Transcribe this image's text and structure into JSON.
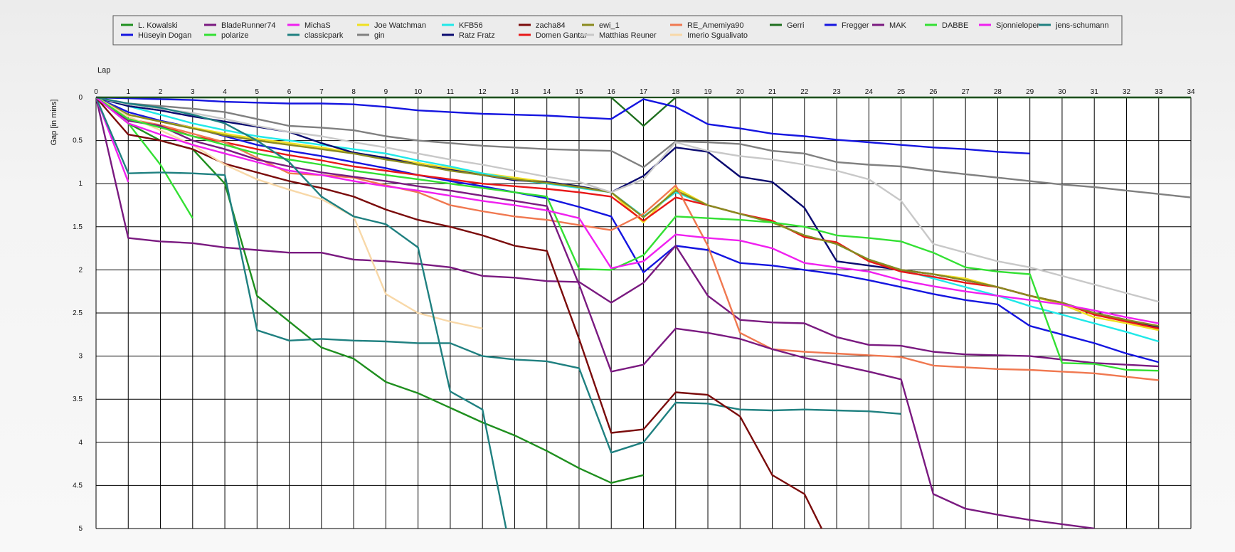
{
  "chart_data": {
    "type": "line",
    "xlabel": "Lap",
    "ylabel": "Gap [in mins]",
    "xlim": [
      0,
      34
    ],
    "ylim": [
      0,
      5
    ],
    "y_inverted": true,
    "x_ticks": [
      0,
      1,
      2,
      3,
      4,
      5,
      6,
      7,
      8,
      9,
      10,
      11,
      12,
      13,
      14,
      15,
      16,
      17,
      18,
      19,
      20,
      21,
      22,
      23,
      24,
      25,
      26,
      27,
      28,
      29,
      30,
      31,
      32,
      33,
      34
    ],
    "y_ticks": [
      0,
      0.5,
      1,
      1.5,
      2,
      2.5,
      3,
      3.5,
      4,
      4.5,
      5
    ],
    "y_tick_labels": [
      "0",
      "0.5",
      "1",
      "1.5",
      "2",
      "2.5",
      "3",
      "3.5",
      "4",
      "4.5",
      "5"
    ],
    "grid": true,
    "legend_position": "top",
    "series": [
      {
        "name": "L. Kowalski",
        "color": "#1f8f1f",
        "values": [
          0,
          0.3,
          0.5,
          0.6,
          1.0,
          2.3,
          2.6,
          2.9,
          3.03,
          3.3,
          3.43,
          3.6,
          3.77,
          3.92,
          4.1,
          4.3,
          4.47,
          4.38
        ]
      },
      {
        "name": "Hüseyin  Dogan",
        "color": "#1515e0",
        "values": [
          0,
          0.17,
          0.27,
          0.35,
          0.45,
          0.55,
          0.62,
          0.68,
          0.75,
          0.82,
          0.9,
          0.97,
          1.03,
          1.1,
          1.17,
          1.27,
          1.38,
          2.03,
          1.72,
          1.77,
          1.92,
          1.95,
          2.0,
          2.05,
          2.12,
          2.2,
          2.28,
          2.35,
          2.4,
          2.65,
          2.75,
          2.85,
          2.97,
          3.07
        ]
      },
      {
        "name": "BladeRunner74",
        "color": "#7a1a80",
        "values": [
          0,
          1.63,
          1.67,
          1.69,
          1.74,
          1.77,
          1.8,
          1.8,
          1.88,
          1.9,
          1.93,
          1.97,
          2.07,
          2.09,
          2.13,
          2.14,
          2.38,
          2.15,
          1.72,
          2.3,
          2.58,
          2.61,
          2.62,
          2.78,
          2.87,
          2.88,
          2.95,
          2.98,
          2.99,
          3.0,
          3.04,
          3.08,
          3.1,
          3.12
        ]
      },
      {
        "name": "polarize",
        "color": "#33e033",
        "values": [
          0,
          0.3,
          0.78,
          1.4
        ]
      },
      {
        "name": "MichaS",
        "color": "#f020f0",
        "values": [
          0,
          0.98
        ]
      },
      {
        "name": "classicpark",
        "color": "#1f8080",
        "values": [
          0,
          0.88,
          0.87,
          0.88,
          0.9,
          2.7,
          2.82,
          2.8,
          2.82,
          2.83,
          2.85,
          2.85,
          3.0,
          3.04,
          3.06,
          3.14,
          4.12,
          4.0,
          3.54,
          3.55,
          3.62,
          3.63,
          3.62,
          3.63,
          3.64,
          3.67
        ]
      },
      {
        "name": "Joe Watchman",
        "color": "#f0e020",
        "values": [
          0,
          0.2,
          0.28,
          0.35,
          0.42,
          0.48,
          0.53,
          0.58,
          0.64,
          0.7,
          0.76,
          0.82,
          0.88,
          0.93,
          0.98,
          1.03,
          1.1,
          1.45,
          1.05,
          1.25,
          1.35,
          1.45,
          1.6,
          1.7,
          1.88,
          2.0,
          2.05,
          2.1,
          2.2,
          2.3,
          2.4,
          2.55,
          2.62,
          2.7
        ]
      },
      {
        "name": "gin",
        "color": "#808080",
        "values": [
          0,
          0.07,
          0.1,
          0.13,
          0.17,
          0.25,
          0.33,
          0.35,
          0.38,
          0.45,
          0.5,
          0.53,
          0.56,
          0.58,
          0.6,
          0.61,
          0.62,
          0.81,
          0.51,
          0.52,
          0.54,
          0.62,
          0.65,
          0.75,
          0.78,
          0.8,
          0.85,
          0.89,
          0.93,
          0.97,
          1.01,
          1.04,
          1.08,
          1.12,
          1.16
        ]
      },
      {
        "name": "KFB56",
        "color": "#20e8e8",
        "values": [
          0,
          0.1,
          0.2,
          0.3,
          0.38,
          0.45,
          0.5,
          0.55,
          0.6,
          0.65,
          0.73,
          0.8,
          0.88,
          0.95,
          1.0,
          1.05,
          1.1,
          1.38,
          1.1,
          1.25,
          1.35,
          1.45,
          1.6,
          1.7,
          1.88,
          2.0,
          2.1,
          2.2,
          2.3,
          2.42,
          2.52,
          2.62,
          2.72,
          2.83
        ]
      },
      {
        "name": "Ratz Fratz",
        "color": "#0a0a70",
        "values": [
          0,
          0.1,
          0.15,
          0.22,
          0.28,
          0.34,
          0.4,
          0.53,
          0.64,
          0.7,
          0.78,
          0.84,
          0.9,
          0.96,
          0.98,
          1.03,
          1.1,
          0.91,
          0.58,
          0.63,
          0.92,
          0.98,
          1.28,
          1.9,
          1.95,
          2.0,
          2.05,
          2.12,
          2.2,
          2.3,
          2.38,
          2.5,
          2.58,
          2.67
        ]
      },
      {
        "name": "zacha84",
        "color": "#7a0a0a",
        "values": [
          0,
          0.43,
          0.5,
          0.6,
          0.77,
          0.87,
          0.97,
          1.05,
          1.15,
          1.3,
          1.42,
          1.5,
          1.6,
          1.72,
          1.78,
          2.8,
          3.89,
          3.85,
          3.42,
          3.45,
          3.7,
          4.38,
          4.6,
          5.35
        ]
      },
      {
        "name": "Domen Gantar",
        "color": "#e81818",
        "values": [
          0,
          0.25,
          0.33,
          0.45,
          0.52,
          0.6,
          0.67,
          0.73,
          0.8,
          0.85,
          0.9,
          0.95,
          1.0,
          1.03,
          1.06,
          1.1,
          1.15,
          1.43,
          1.16,
          1.25,
          1.35,
          1.43,
          1.62,
          1.68,
          1.9,
          2.02,
          2.08,
          2.15,
          2.2,
          2.3,
          2.38,
          2.52,
          2.6,
          2.68
        ]
      },
      {
        "name": "ewi_1",
        "color": "#8a8a1f",
        "values": [
          0,
          0.2,
          0.28,
          0.36,
          0.44,
          0.5,
          0.55,
          0.6,
          0.65,
          0.72,
          0.78,
          0.85,
          0.9,
          0.95,
          0.99,
          1.04,
          1.1,
          1.39,
          1.08,
          1.25,
          1.35,
          1.45,
          1.6,
          1.7,
          1.88,
          2.0,
          2.05,
          2.12,
          2.2,
          2.3,
          2.38,
          2.5,
          2.58,
          2.65
        ]
      },
      {
        "name": "Matthias Reuner",
        "color": "#c8c8c8",
        "values": [
          0,
          0.08,
          0.13,
          0.18,
          0.25,
          0.33,
          0.4,
          0.45,
          0.52,
          0.58,
          0.65,
          0.72,
          0.78,
          0.85,
          0.92,
          0.98,
          1.1,
          0.95,
          0.52,
          0.62,
          0.68,
          0.72,
          0.78,
          0.85,
          0.95,
          1.2,
          1.7,
          1.8,
          1.9,
          1.97,
          2.07,
          2.17,
          2.27,
          2.37
        ]
      },
      {
        "name": "RE_Amemiya90",
        "color": "#f07850",
        "values": [
          0,
          0.25,
          0.32,
          0.42,
          0.52,
          0.7,
          0.88,
          0.9,
          0.93,
          1.02,
          1.1,
          1.25,
          1.32,
          1.38,
          1.42,
          1.48,
          1.54,
          1.35,
          1.02,
          1.72,
          2.73,
          2.92,
          2.95,
          2.97,
          2.99,
          3.01,
          3.11,
          3.13,
          3.15,
          3.16,
          3.18,
          3.2,
          3.24,
          3.28
        ]
      },
      {
        "name": "Imerio Sgualivato",
        "color": "#f8d8a8",
        "values": [
          0,
          0.22,
          0.38,
          0.55,
          0.78,
          0.95,
          1.07,
          1.18,
          1.38,
          2.28,
          2.5,
          2.6,
          2.68
        ]
      },
      {
        "name": "Gerri",
        "color": "#1f6f1f",
        "values": [
          0,
          0,
          0,
          0,
          0,
          0,
          0,
          0,
          0,
          0,
          0,
          0,
          0,
          0,
          0,
          0,
          0,
          0.33,
          0,
          0,
          0,
          0,
          0,
          0,
          0,
          0,
          0,
          0,
          0,
          0,
          0,
          0,
          0,
          0,
          0
        ]
      },
      {
        "name": "Fregger",
        "color": "#1515e0",
        "values": [
          0,
          0.01,
          0.02,
          0.03,
          0.05,
          0.06,
          0.07,
          0.07,
          0.08,
          0.11,
          0.15,
          0.17,
          0.19,
          0.2,
          0.21,
          0.23,
          0.25,
          0.02,
          0.11,
          0.31,
          0.36,
          0.42,
          0.45,
          0.49,
          0.52,
          0.55,
          0.58,
          0.6,
          0.63,
          0.65
        ]
      },
      {
        "name": "MAK",
        "color": "#7a1a80",
        "values": [
          0,
          0.27,
          0.33,
          0.5,
          0.6,
          0.72,
          0.8,
          0.87,
          0.92,
          0.97,
          1.03,
          1.08,
          1.14,
          1.2,
          1.26,
          2.17,
          3.18,
          3.1,
          2.68,
          2.73,
          2.8,
          2.92,
          3.02,
          3.1,
          3.18,
          3.27,
          4.6,
          4.77,
          4.84,
          4.9,
          4.95,
          5.0
        ]
      },
      {
        "name": "DABBE",
        "color": "#33e033",
        "values": [
          0,
          0.25,
          0.35,
          0.45,
          0.55,
          0.65,
          0.72,
          0.78,
          0.85,
          0.9,
          0.95,
          1.0,
          1.05,
          1.1,
          1.15,
          1.99,
          2.0,
          1.83,
          1.38,
          1.4,
          1.42,
          1.45,
          1.5,
          1.6,
          1.63,
          1.67,
          1.8,
          1.97,
          2.02,
          2.05,
          3.08,
          3.09,
          3.16,
          3.17
        ]
      },
      {
        "name": "Sjonnieloper",
        "color": "#f020f0",
        "values": [
          0,
          0.3,
          0.43,
          0.55,
          0.65,
          0.75,
          0.85,
          0.9,
          0.97,
          1.03,
          1.08,
          1.14,
          1.2,
          1.25,
          1.31,
          1.4,
          1.98,
          1.9,
          1.59,
          1.63,
          1.66,
          1.75,
          1.92,
          1.97,
          2.02,
          2.12,
          2.19,
          2.25,
          2.3,
          2.35,
          2.4,
          2.47,
          2.55,
          2.62
        ]
      },
      {
        "name": "jens-schumann",
        "color": "#1f8080",
        "values": [
          0,
          0.07,
          0.12,
          0.2,
          0.3,
          0.5,
          0.75,
          1.15,
          1.38,
          1.47,
          1.74,
          3.41,
          3.62,
          5.5
        ]
      }
    ]
  }
}
